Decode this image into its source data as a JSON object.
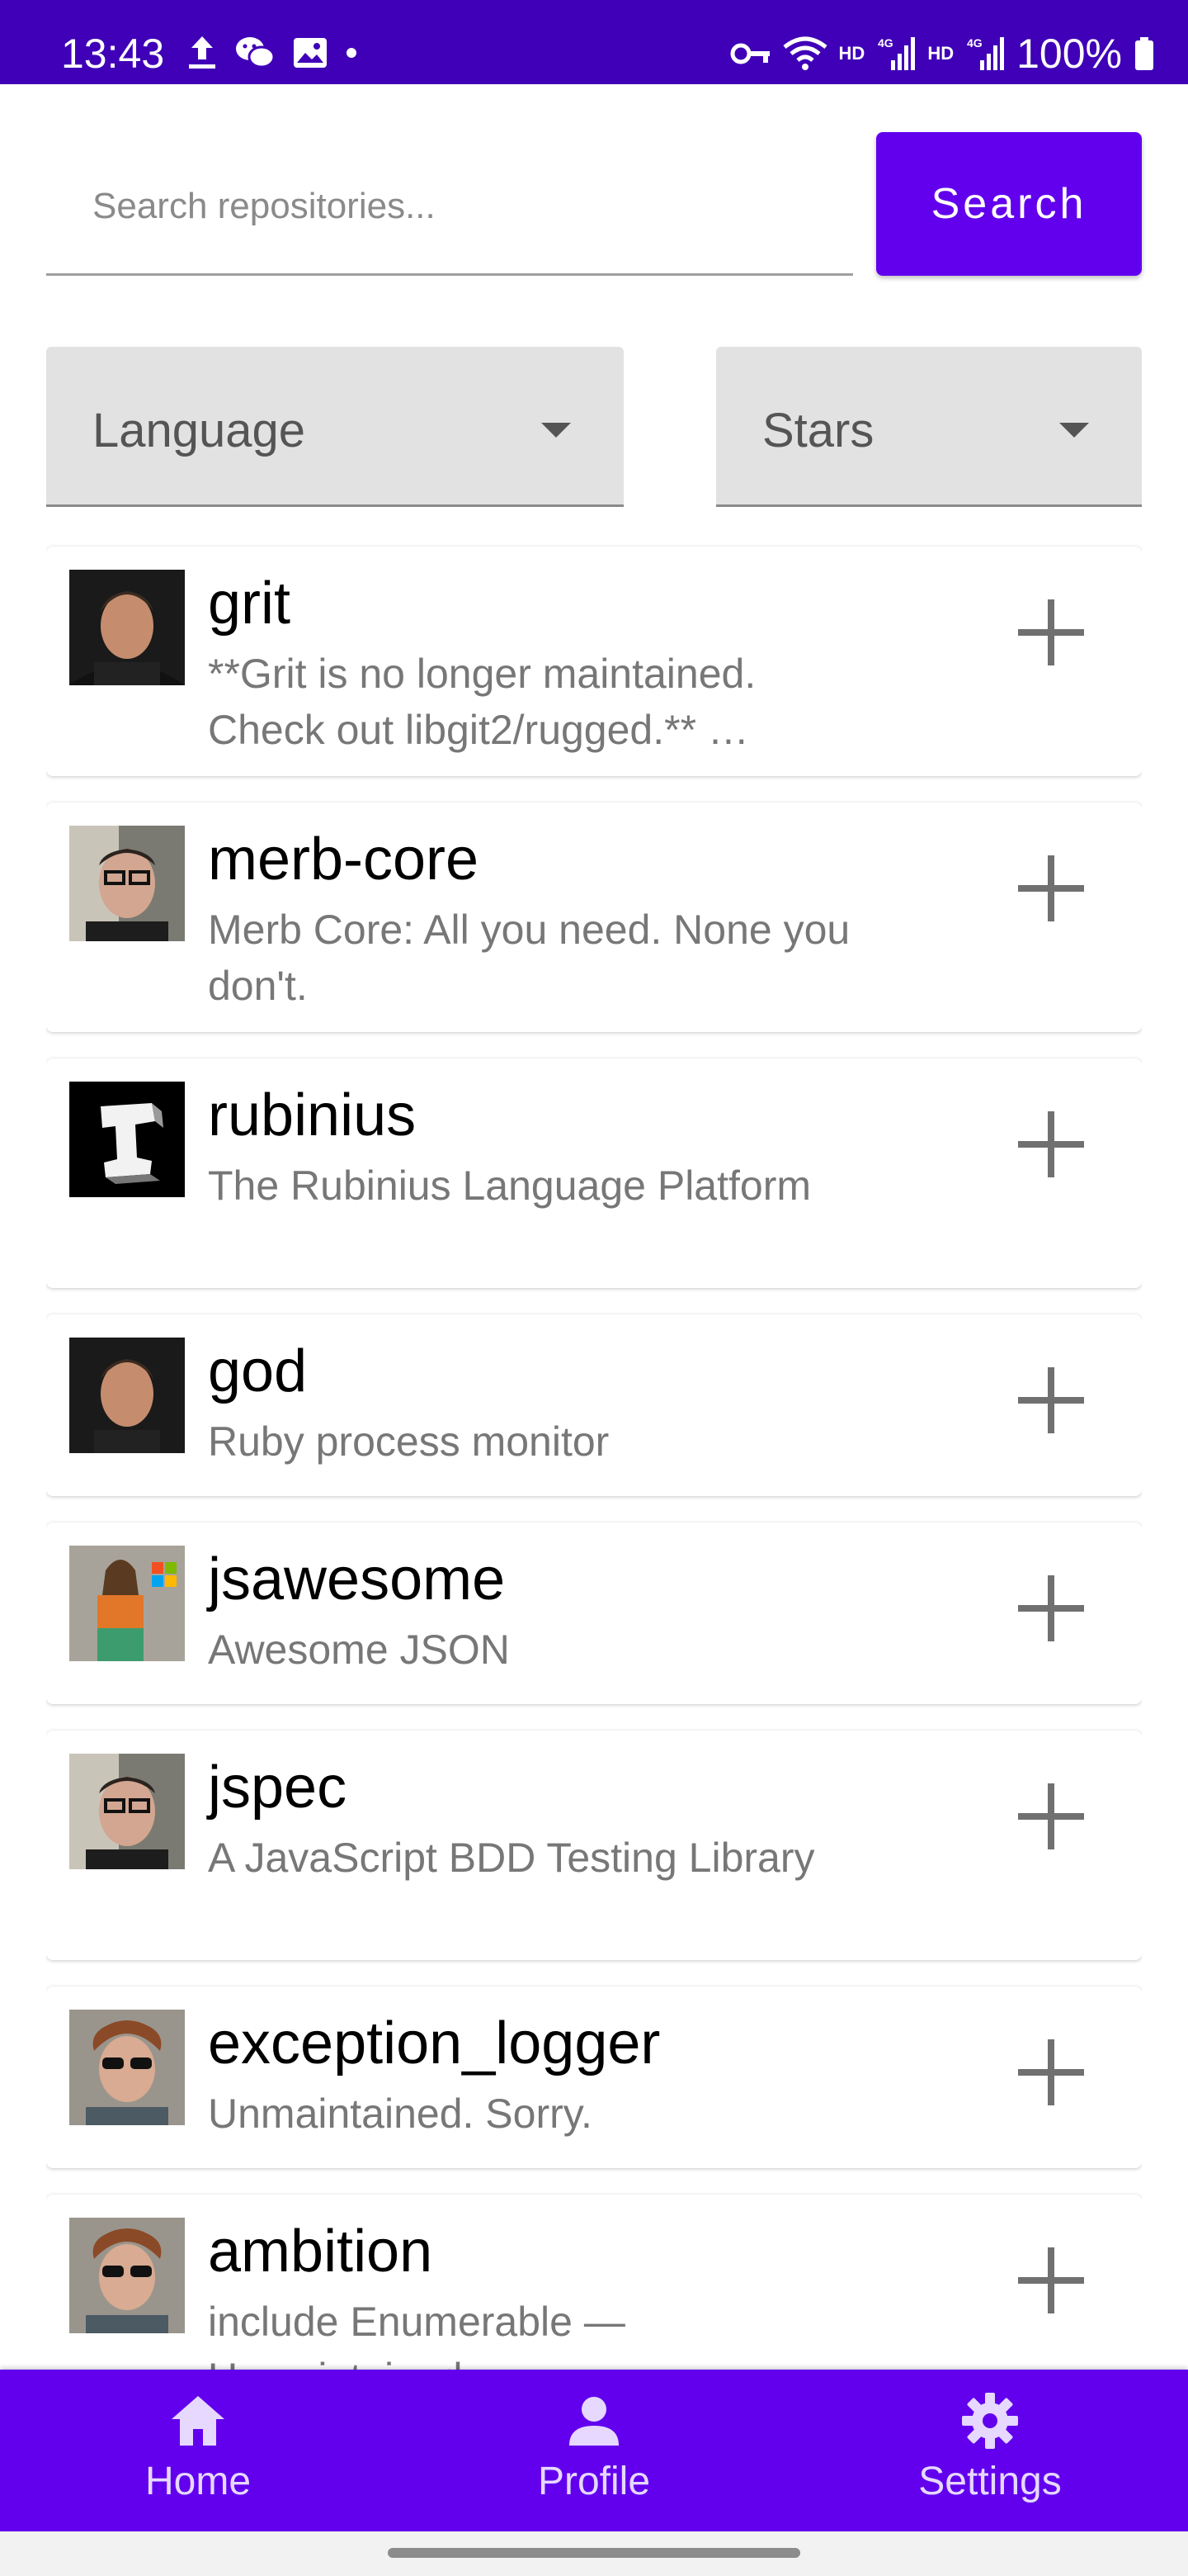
{
  "status_bar": {
    "time": "13:43",
    "left_icons": [
      "upload-icon",
      "wechat-icon",
      "image-icon",
      "dot-icon"
    ],
    "right_icons": [
      "vpn-key-icon",
      "wifi-icon",
      "signal-icon",
      "signal-icon"
    ],
    "hd_label_1": "HD",
    "hd_label_2": "HD",
    "net_label_1": "4G",
    "net_label_2": "4G",
    "battery": "100%"
  },
  "search": {
    "placeholder": "Search repositories...",
    "value": "",
    "button_label": "Search"
  },
  "filters": {
    "language": {
      "label": "Language"
    },
    "stars": {
      "label": "Stars"
    }
  },
  "repos": [
    {
      "name": "grit",
      "description": "**Grit is no longer maintained. Check out libgit2/rugged.** …"
    },
    {
      "name": "merb-core",
      "description": "Merb Core: All you need. None you don't."
    },
    {
      "name": "rubinius",
      "description": "The Rubinius Language Platform"
    },
    {
      "name": "god",
      "description": "Ruby process monitor"
    },
    {
      "name": "jsawesome",
      "description": "Awesome JSON"
    },
    {
      "name": "jspec",
      "description": "A JavaScript BDD Testing Library"
    },
    {
      "name": "exception_logger",
      "description": "Unmaintained. Sorry."
    },
    {
      "name": "ambition",
      "description": "include Enumerable — Unmaintained"
    }
  ],
  "bottom_nav": {
    "home": "Home",
    "profile": "Profile",
    "settings": "Settings"
  },
  "colors": {
    "status_bar": "#3f00b7",
    "primary": "#6200ee",
    "dropdown_bg": "#e2e2e2"
  }
}
